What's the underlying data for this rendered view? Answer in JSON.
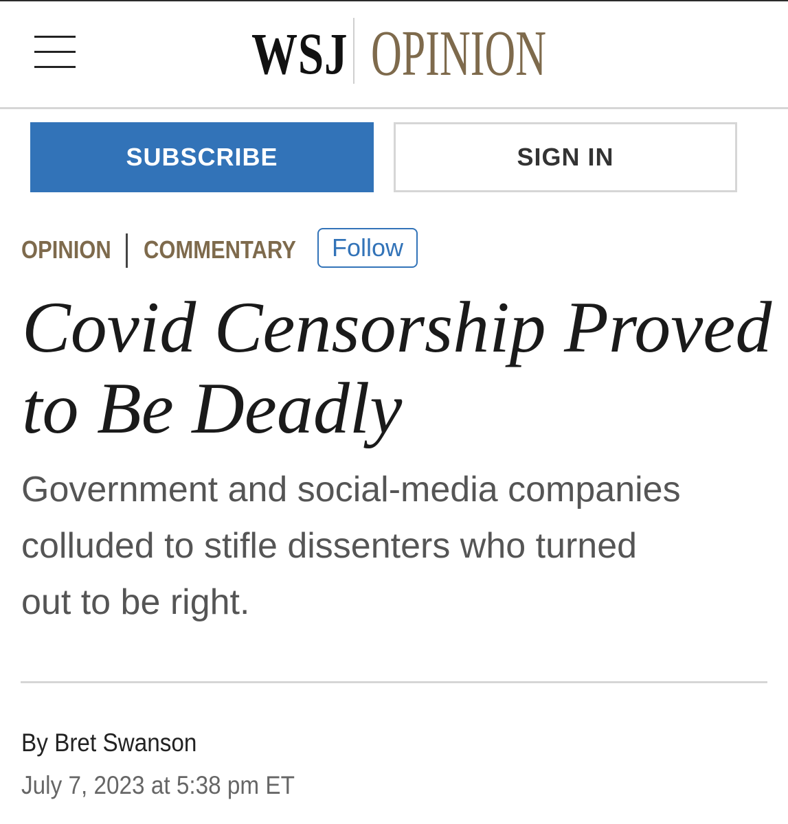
{
  "header": {
    "menu_icon": "hamburger-menu-icon",
    "logo_wsj": "WSJ",
    "logo_section": "OPINION",
    "brand_color": "#7e6a4c"
  },
  "actions": {
    "subscribe_label": "SUBSCRIBE",
    "signin_label": "SIGN IN",
    "subscribe_color": "#3273b8"
  },
  "article": {
    "categories": [
      "OPINION",
      "COMMENTARY"
    ],
    "follow_label": "Follow",
    "headline_lines": [
      "Covid Censorship Proved",
      "to Be Deadly"
    ],
    "dek_lines": [
      "Government and social-media companies",
      "colluded to stifle dissenters who turned",
      "out to be right."
    ],
    "byline_prefix": "By ",
    "author": "Bret Swanson",
    "date": "July 7, 2023 at 5:38 pm ET"
  }
}
